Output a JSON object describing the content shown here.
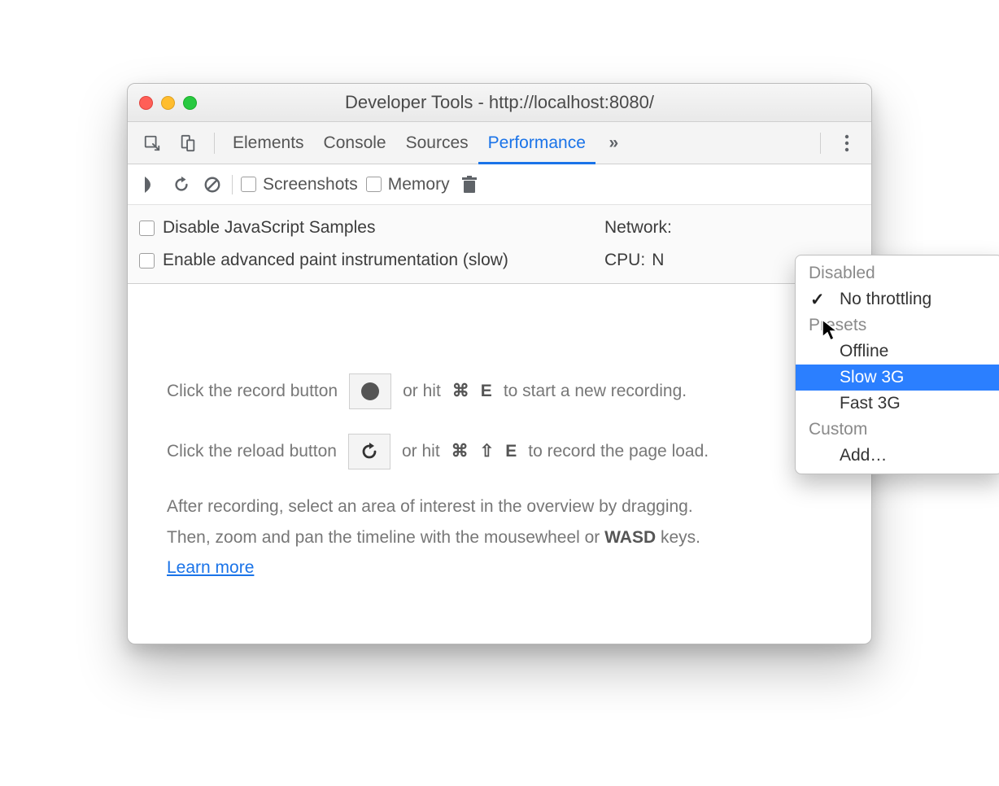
{
  "window": {
    "title": "Developer Tools - http://localhost:8080/"
  },
  "tabs": {
    "elements": "Elements",
    "console": "Console",
    "sources": "Sources",
    "performance": "Performance"
  },
  "toolbar": {
    "screenshots": "Screenshots",
    "memory": "Memory"
  },
  "settings": {
    "disable_js_samples": "Disable JavaScript Samples",
    "enable_paint": "Enable advanced paint instrumentation (slow)",
    "network_label": "Network:",
    "cpu_label": "CPU:",
    "cpu_value": "N"
  },
  "instructions": {
    "line1a": "Click the record button",
    "line1b": "or hit",
    "key1": "⌘",
    "key1b": "E",
    "line1c": "to start a new recording.",
    "line2a": "Click the reload button",
    "line2b": "or hit",
    "key2a": "⌘",
    "key2b": "⇧",
    "key2c": "E",
    "line2c": "to record the page load.",
    "para1": "After recording, select an area of interest in the overview by dragging.",
    "para2a": "Then, zoom and pan the timeline with the mousewheel or ",
    "para2b": "WASD",
    "para2c": " keys.",
    "learn_more": "Learn more"
  },
  "dropdown": {
    "header_disabled": "Disabled",
    "no_throttling": "No throttling",
    "header_presets": "Presets",
    "offline": "Offline",
    "slow_3g": "Slow 3G",
    "fast_3g": "Fast 3G",
    "header_custom": "Custom",
    "add": "Add…"
  }
}
